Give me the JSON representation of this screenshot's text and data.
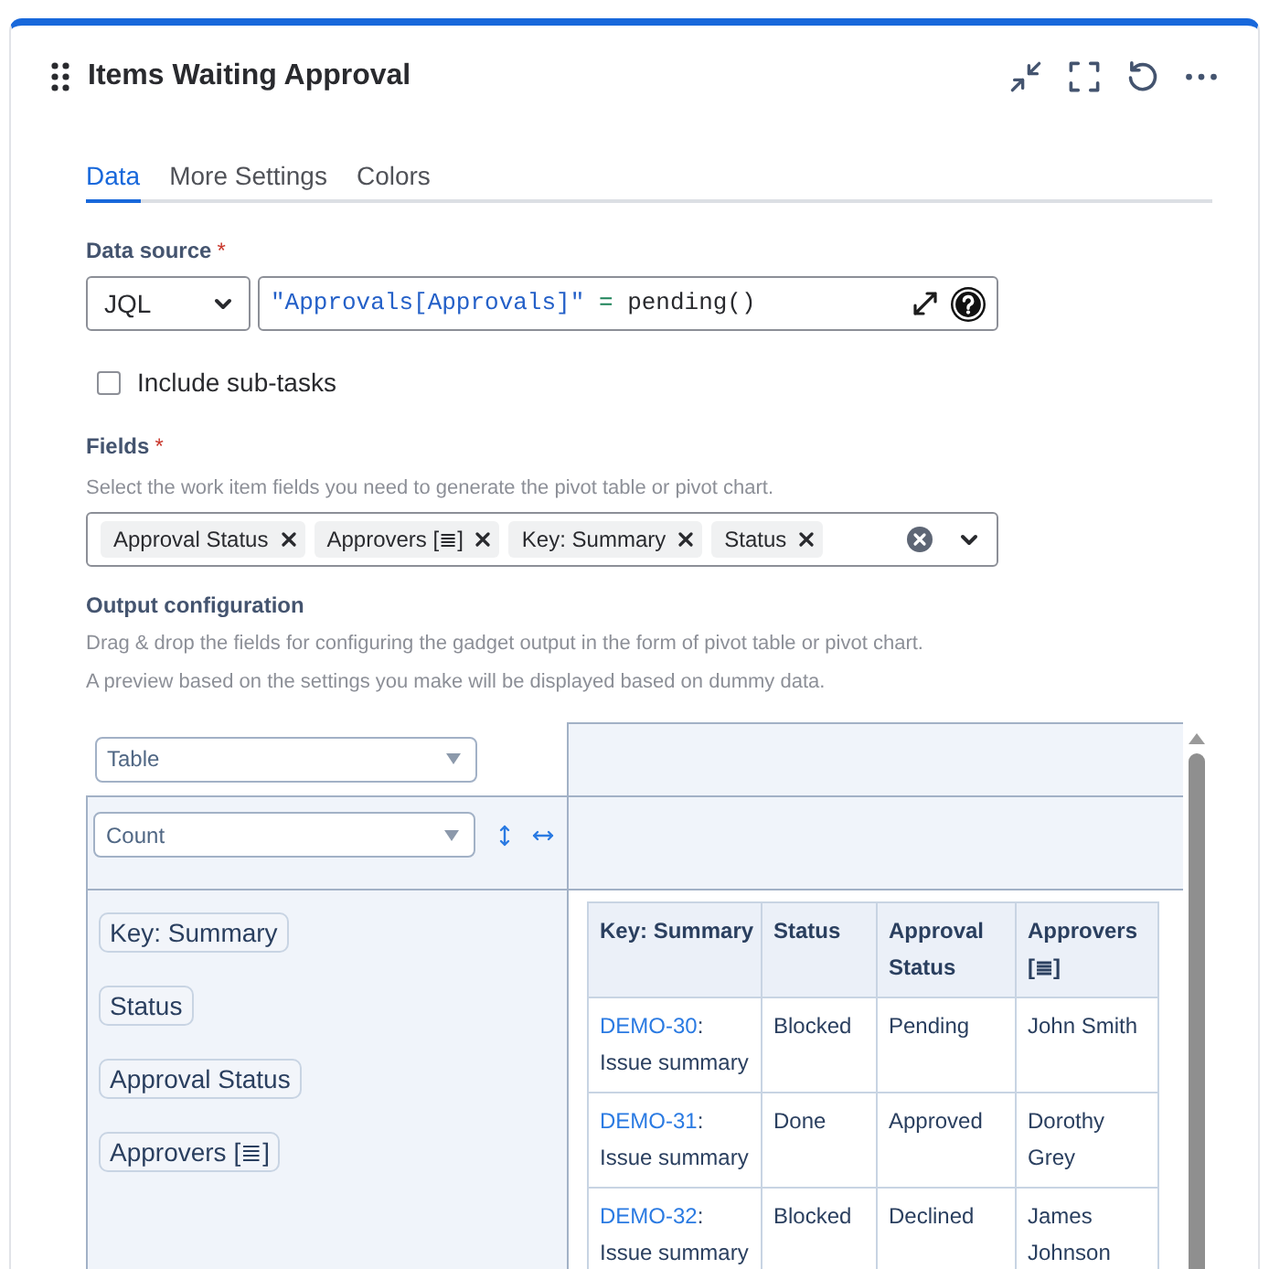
{
  "widget": {
    "title": "Items Waiting Approval"
  },
  "tabs": [
    {
      "label": "Data",
      "selected": true
    },
    {
      "label": "More Settings",
      "selected": false
    },
    {
      "label": "Colors",
      "selected": false
    }
  ],
  "data_source": {
    "label": "Data source",
    "required_mark": "*",
    "type": "JQL",
    "query_tokens": [
      {
        "kind": "string",
        "text": "\"Approvals[Approvals]\""
      },
      {
        "kind": "operator",
        "text": "="
      },
      {
        "kind": "function",
        "text": "pending()"
      }
    ]
  },
  "include_subtasks": {
    "label": "Include sub-tasks",
    "checked": false
  },
  "fields": {
    "label": "Fields",
    "required_mark": "*",
    "help": "Select the work item fields you need to generate the pivot table or pivot chart.",
    "tags": [
      "Approval Status",
      "Approvers [≣]",
      "Key: Summary",
      "Status"
    ]
  },
  "output_configuration": {
    "title": "Output configuration",
    "help": [
      "Drag & drop the fields for configuring the gadget output in the form of pivot table or pivot chart.",
      "A preview based on the settings you make will be displayed based on dummy data."
    ],
    "renderer": "Table",
    "aggregator": "Count",
    "row_fields": [
      "Key: Summary",
      "Status",
      "Approval Status",
      "Approvers [≣]"
    ]
  },
  "preview_table": {
    "columns": [
      "Key: Summary",
      "Status",
      "Approval Status",
      "Approvers [≣]"
    ],
    "rows": [
      {
        "cells": [
          {
            "kind": "issue",
            "link": "DEMO-30",
            "text": ": Issue summary"
          },
          {
            "kind": "text",
            "text": "Blocked"
          },
          {
            "kind": "text",
            "text": "Pending"
          },
          {
            "kind": "text",
            "text": "John Smith"
          }
        ]
      },
      {
        "cells": [
          {
            "kind": "issue",
            "link": "DEMO-31",
            "text": ": Issue summary"
          },
          {
            "kind": "text",
            "text": "Done"
          },
          {
            "kind": "text",
            "text": "Approved"
          },
          {
            "kind": "text",
            "text": "Dorothy Grey"
          }
        ]
      },
      {
        "cells": [
          {
            "kind": "issue",
            "link": "DEMO-32",
            "text": ": Issue summary"
          },
          {
            "kind": "text",
            "text": "Blocked"
          },
          {
            "kind": "text",
            "text": "Declined"
          },
          {
            "kind": "text",
            "text": "James Johnson"
          }
        ]
      }
    ]
  }
}
